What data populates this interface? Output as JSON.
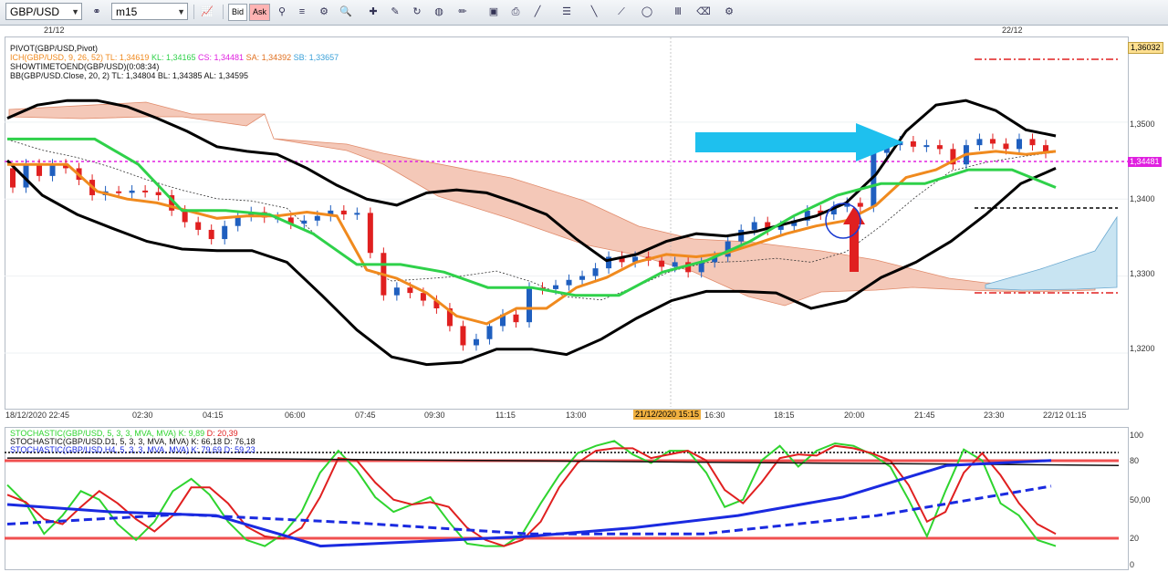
{
  "toolbar": {
    "symbol": "GBP/USD",
    "timeframe": "m15",
    "bid_label": "Bid",
    "ask_label": "Ask"
  },
  "top_dates": [
    "21/12",
    "22/12"
  ],
  "legend_main": {
    "pivot": "PIVOT(GBP/USD,Pivot)",
    "ich_name": "ICH(GBP/USD, 9, 26, 52)",
    "ich_tl": "TL: 1,34619",
    "ich_kl": "KL: 1,34165",
    "ich_cs": "CS: 1,34481",
    "ich_sa": "SA: 1,34392",
    "ich_sb": "SB: 1,33657",
    "showtime": "SHOWTIMETOEND(GBP/USD)(0:08:34)",
    "bb": "BB(GBP/USD.Close, 20, 2)  TL: 1,34804  BL: 1,34385  AL: 1,34595"
  },
  "legend_stoch": {
    "s1_name": "STOCHASTIC(GBP/USD, 5, 3, 3, MVA, MVA)",
    "s1_k": "K: 9,89",
    "s1_d": "D: 20,39",
    "s2": "STOCHASTIC(GBP/USD.D1, 5, 3, 3, MVA, MVA)  K: 66,18  D: 76,18",
    "s3": "STOCHASTIC(GBP/USD.H4, 5, 3, 3, MVA, MVA)  K: 79,69  D: 59,23"
  },
  "price_axis": {
    "ticks": [
      "1,3500",
      "1,3400",
      "1,3300",
      "1,3200"
    ],
    "top_tag": "1,36032",
    "current_tag": "1,34481"
  },
  "stoch_axis": [
    "100",
    "80",
    "50,00",
    "20",
    "0"
  ],
  "time_axis": [
    "18/12/2020 22:45",
    "02:30",
    "04:15",
    "06:00",
    "07:45",
    "09:30",
    "11:15",
    "13:00",
    "21/12/2020 15:15",
    "16:30",
    "18:15",
    "20:00",
    "21:45",
    "23:30",
    "22/12 01:15"
  ],
  "colors": {
    "bull": "#1f5fbf",
    "bear": "#e02020",
    "bb": "#000000",
    "tenkan": "#f08a1e",
    "kijun": "#2fd14a",
    "cloud_bear": "#f4c8b8",
    "cloud_bull": "#c8e4f2",
    "pivot": "#e020e0",
    "arrow": "#1ec0ee"
  },
  "chart_data": [
    {
      "type": "candlestick",
      "title": "GBP/USD m15",
      "ylim": [
        1.313,
        1.361
      ],
      "series": [
        {
          "name": "GBP/USD",
          "values": [
            1.3415,
            1.3445,
            1.343,
            1.3445,
            1.344,
            1.3425,
            1.3405,
            1.341,
            1.3408,
            1.3411,
            1.3409,
            1.3405,
            1.3385,
            1.337,
            1.336,
            1.3348,
            1.3365,
            1.3378,
            1.3383,
            1.3376,
            1.3376,
            1.3368,
            1.3372,
            1.3378,
            1.3385,
            1.338,
            1.3382,
            1.333,
            1.3275,
            1.3285,
            1.3278,
            1.3268,
            1.3258,
            1.3235,
            1.321,
            1.3218,
            1.3235,
            1.325,
            1.324,
            1.3285,
            1.3283,
            1.3288,
            1.3295,
            1.33,
            1.331,
            1.3325,
            1.3318,
            1.3325,
            1.332,
            1.3312,
            1.3318,
            1.3305,
            1.3318,
            1.3325,
            1.3345,
            1.336,
            1.337,
            1.336,
            1.3365,
            1.3372,
            1.3385,
            1.338,
            1.339,
            1.3395,
            1.339,
            1.346,
            1.347,
            1.3475,
            1.3468,
            1.347,
            1.3465,
            1.3445,
            1.347,
            1.3478,
            1.3472,
            1.3465,
            1.3478,
            1.347,
            1.346
          ]
        },
        {
          "name": "BB upper",
          "values": [
            1.3505,
            1.3522,
            1.3528,
            1.3528,
            1.352,
            1.3505,
            1.3488,
            1.3468,
            1.3462,
            1.3458,
            1.344,
            1.3418,
            1.34,
            1.3392,
            1.3408,
            1.3412,
            1.3408,
            1.3395,
            1.338,
            1.3348,
            1.332,
            1.3328,
            1.3345,
            1.3355,
            1.3352,
            1.3358,
            1.3368,
            1.3378,
            1.3395,
            1.3432,
            1.3488,
            1.3522,
            1.3528,
            1.3515,
            1.349,
            1.3482
          ]
        },
        {
          "name": "BB lower",
          "values": [
            1.345,
            1.3405,
            1.338,
            1.3362,
            1.3345,
            1.3335,
            1.3333,
            1.3333,
            1.3318,
            1.3275,
            1.323,
            1.3195,
            1.3185,
            1.3188,
            1.3205,
            1.3205,
            1.3198,
            1.3218,
            1.3245,
            1.3268,
            1.328,
            1.328,
            1.3278,
            1.3258,
            1.3268,
            1.3298,
            1.3318,
            1.3345,
            1.338,
            1.342,
            1.344
          ]
        },
        {
          "name": "Tenkan",
          "values": [
            1.3445,
            1.3445,
            1.3445,
            1.341,
            1.34,
            1.3395,
            1.3385,
            1.3375,
            1.3378,
            1.3378,
            1.3383,
            1.3378,
            1.3308,
            1.3297,
            1.3278,
            1.3248,
            1.3238,
            1.3258,
            1.3258,
            1.3285,
            1.3298,
            1.3318,
            1.3328,
            1.3325,
            1.333,
            1.3342,
            1.3355,
            1.3365,
            1.3372,
            1.3392,
            1.3428,
            1.3438,
            1.3458,
            1.3462,
            1.3458,
            1.3462
          ]
        },
        {
          "name": "Kijun",
          "values": [
            1.3478,
            1.3478,
            1.3478,
            1.3445,
            1.3385,
            1.3385,
            1.338,
            1.3355,
            1.3315,
            1.3315,
            1.3305,
            1.3285,
            1.3285,
            1.3275,
            1.3275,
            1.3305,
            1.332,
            1.3345,
            1.3378,
            1.3405,
            1.342,
            1.342,
            1.3438,
            1.3438,
            1.3415
          ]
        }
      ]
    },
    {
      "type": "line",
      "title": "STOCHASTIC",
      "ylim": [
        0,
        100
      ],
      "series": [
        {
          "name": "STOCHASTIC(GBP/USD, 5, 3, 3, MVA, MVA) K",
          "values": [
            60,
            45,
            20,
            35,
            55,
            48,
            28,
            15,
            30,
            55,
            65,
            52,
            30,
            15,
            10,
            20,
            38,
            70,
            88,
            72,
            50,
            38,
            44,
            50,
            30,
            12,
            10,
            10,
            20,
            45,
            68,
            86,
            92,
            96,
            85,
            78,
            88,
            88,
            70,
            42,
            48,
            80,
            92,
            75,
            88,
            94,
            92,
            85,
            75,
            48,
            18,
            55,
            89,
            80,
            45,
            35,
            15,
            10
          ]
        },
        {
          "name": "STOCHASTIC(GBP/USD, 5, 3, 3, MVA, MVA) D",
          "values": [
            52,
            46,
            32,
            28,
            42,
            55,
            45,
            32,
            22,
            35,
            58,
            58,
            45,
            26,
            18,
            16,
            25,
            50,
            82,
            80,
            62,
            48,
            44,
            46,
            42,
            25,
            15,
            10,
            15,
            30,
            58,
            78,
            88,
            90,
            90,
            82,
            85,
            88,
            80,
            56,
            45,
            62,
            82,
            85,
            84,
            92,
            90,
            86,
            80,
            60,
            30,
            38,
            70,
            86,
            68,
            45,
            28,
            20
          ]
        },
        {
          "name": "STOCHASTIC(GBP/USD.D1, 5, 3, 3, MVA, MVA)",
          "values": [
            82,
            82,
            81,
            80,
            79,
            78,
            77,
            76
          ]
        },
        {
          "name": "STOCHASTIC(GBP/USD.H4, 5, 3, 3, MVA, MVA) K",
          "values": [
            44,
            38,
            35,
            10,
            14,
            18,
            25,
            35,
            50,
            76,
            80
          ]
        },
        {
          "name": "STOCHASTIC(GBP/USD.H4, 5, 3, 3, MVA, MVA) D",
          "values": [
            28,
            36,
            29,
            20,
            20,
            35,
            59
          ]
        }
      ]
    }
  ]
}
